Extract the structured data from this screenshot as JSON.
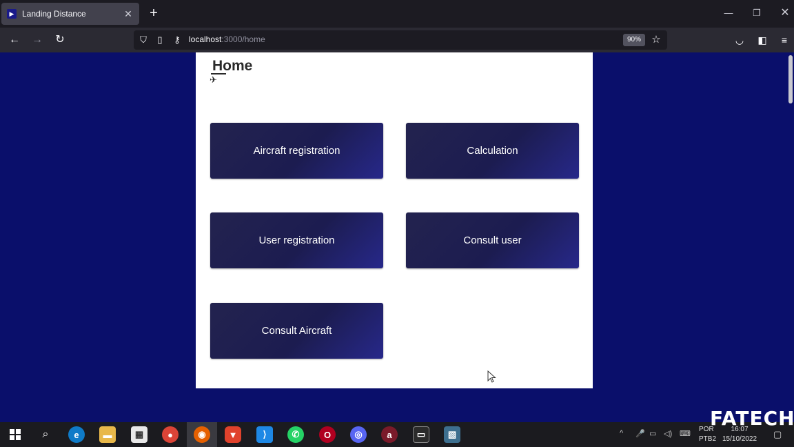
{
  "browser": {
    "tab_title": "Landing Distance",
    "url_host": "localhost",
    "url_path": ":3000/home",
    "zoom": "90%"
  },
  "page": {
    "title": "Home",
    "buttons": [
      {
        "label": "Aircraft registration"
      },
      {
        "label": "Calculation"
      },
      {
        "label": "User registration"
      },
      {
        "label": "Consult user"
      },
      {
        "label": "Consult Aircraft"
      }
    ]
  },
  "taskbar": {
    "lang_line1": "POR",
    "lang_line2": "PTB2",
    "time": "16:07",
    "date": "15/10/2022"
  },
  "watermark": "FATECH",
  "colors": {
    "page_background": "#0a0f6b",
    "button_background": "#1e1e55",
    "card_background": "#ffffff"
  }
}
